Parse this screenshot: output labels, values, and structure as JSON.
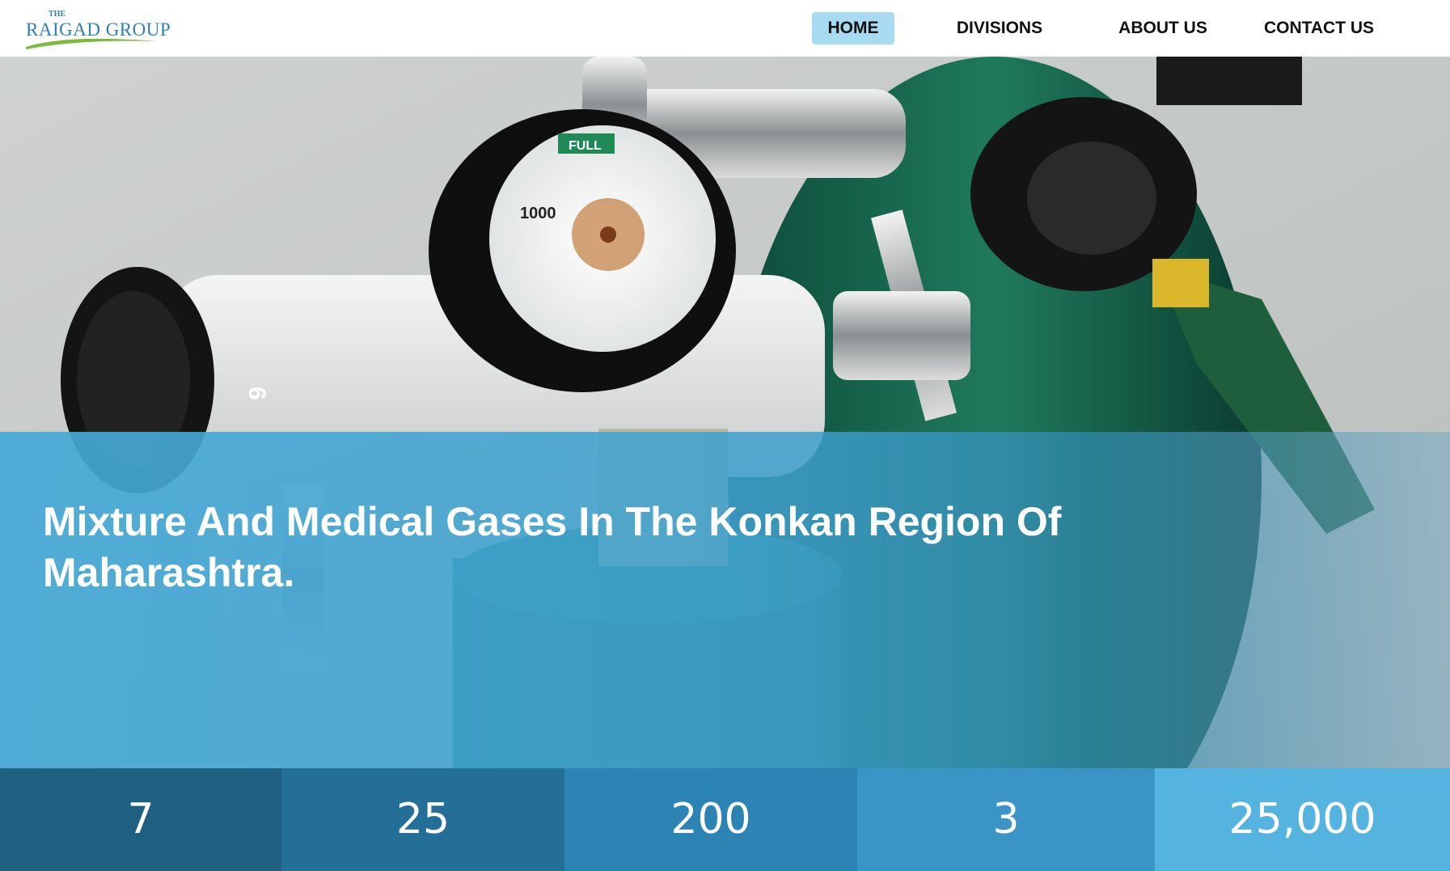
{
  "brand": {
    "the": "THE",
    "name": "RAIGAD GROUP",
    "primary_color": "#2f7fb5",
    "swoosh_color": "#7dbb3f"
  },
  "nav": {
    "items": [
      {
        "label": "HOME",
        "active": true
      },
      {
        "label": "DIVISIONS",
        "active": false
      },
      {
        "label": "ABOUT US",
        "active": false
      },
      {
        "label": "CONTACT US",
        "active": false
      }
    ],
    "active_color": "#a8dbf1"
  },
  "hero": {
    "headline": "Mixture And Medical Gases In The Konkan Region Of Maharashtra.",
    "image": "oxygen-cylinder-regulator-photo",
    "gauge_label": "FULL",
    "gauge_number": "1000"
  },
  "stats": [
    {
      "value": "7"
    },
    {
      "value": "25"
    },
    {
      "value": "200"
    },
    {
      "value": "3"
    },
    {
      "value": "25,000"
    }
  ]
}
